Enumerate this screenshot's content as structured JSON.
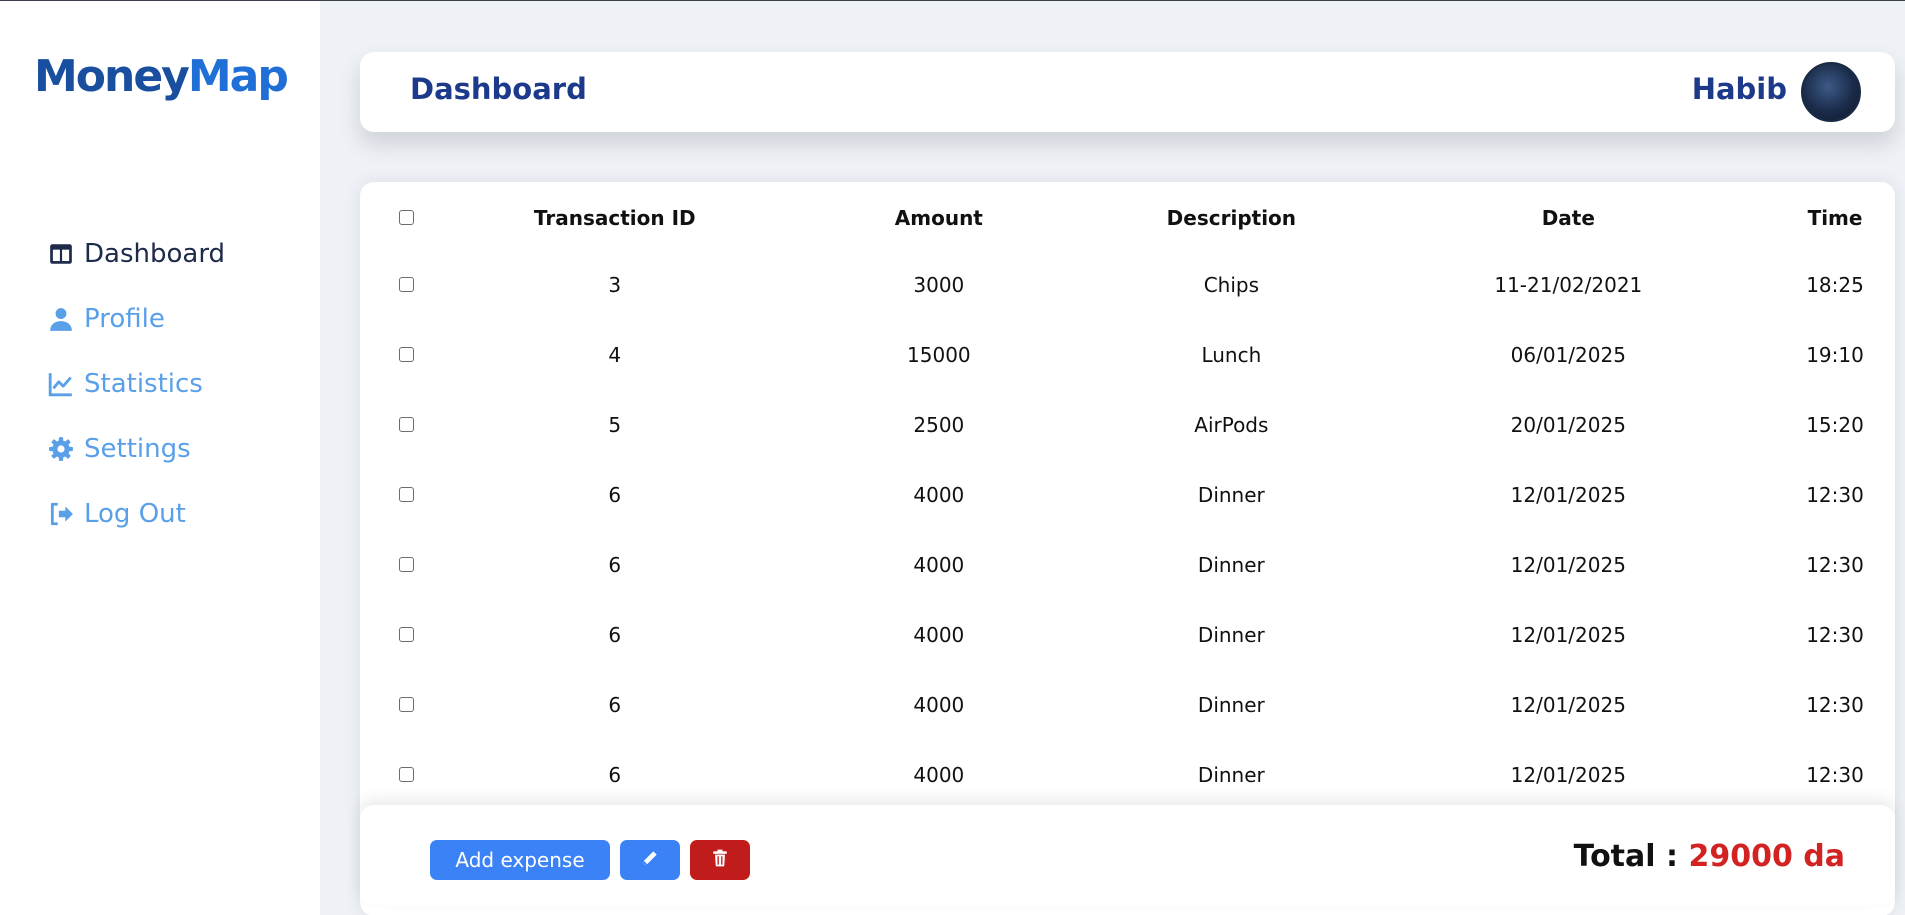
{
  "brand": {
    "logo_part1": "Money",
    "logo_part2": "Map"
  },
  "sidebar": {
    "items": [
      {
        "label": "Dashboard",
        "icon": "dashboard-icon",
        "active": true
      },
      {
        "label": "Profile",
        "icon": "user-icon",
        "active": false
      },
      {
        "label": "Statistics",
        "icon": "chart-line-icon",
        "active": false
      },
      {
        "label": "Settings",
        "icon": "gear-icon",
        "active": false
      },
      {
        "label": "Log Out",
        "icon": "logout-icon",
        "active": false
      }
    ]
  },
  "header": {
    "title": "Dashboard",
    "username": "Habib"
  },
  "table": {
    "columns": [
      "Transaction ID",
      "Amount",
      "Description",
      "Date",
      "Time"
    ],
    "rows": [
      {
        "id": "3",
        "amount": "3000",
        "description": "Chips",
        "date": "11-21/02/2021",
        "time": "18:25"
      },
      {
        "id": "4",
        "amount": "15000",
        "description": "Lunch",
        "date": "06/01/2025",
        "time": "19:10"
      },
      {
        "id": "5",
        "amount": "2500",
        "description": "AirPods",
        "date": "20/01/2025",
        "time": "15:20"
      },
      {
        "id": "6",
        "amount": "4000",
        "description": "Dinner",
        "date": "12/01/2025",
        "time": "12:30"
      },
      {
        "id": "6",
        "amount": "4000",
        "description": "Dinner",
        "date": "12/01/2025",
        "time": "12:30"
      },
      {
        "id": "6",
        "amount": "4000",
        "description": "Dinner",
        "date": "12/01/2025",
        "time": "12:30"
      },
      {
        "id": "6",
        "amount": "4000",
        "description": "Dinner",
        "date": "12/01/2025",
        "time": "12:30"
      },
      {
        "id": "6",
        "amount": "4000",
        "description": "Dinner",
        "date": "12/01/2025",
        "time": "12:30"
      }
    ]
  },
  "footer": {
    "add_label": "Add expense",
    "edit_icon": "pencil-icon",
    "delete_icon": "trash-icon",
    "total_label": "Total :",
    "total_value": "29000 da"
  },
  "colors": {
    "primary": "#3b82f6",
    "title": "#1d3a8a",
    "danger": "#c01c1c",
    "total": "#d32222",
    "nav_inactive": "#5aa0e8"
  }
}
